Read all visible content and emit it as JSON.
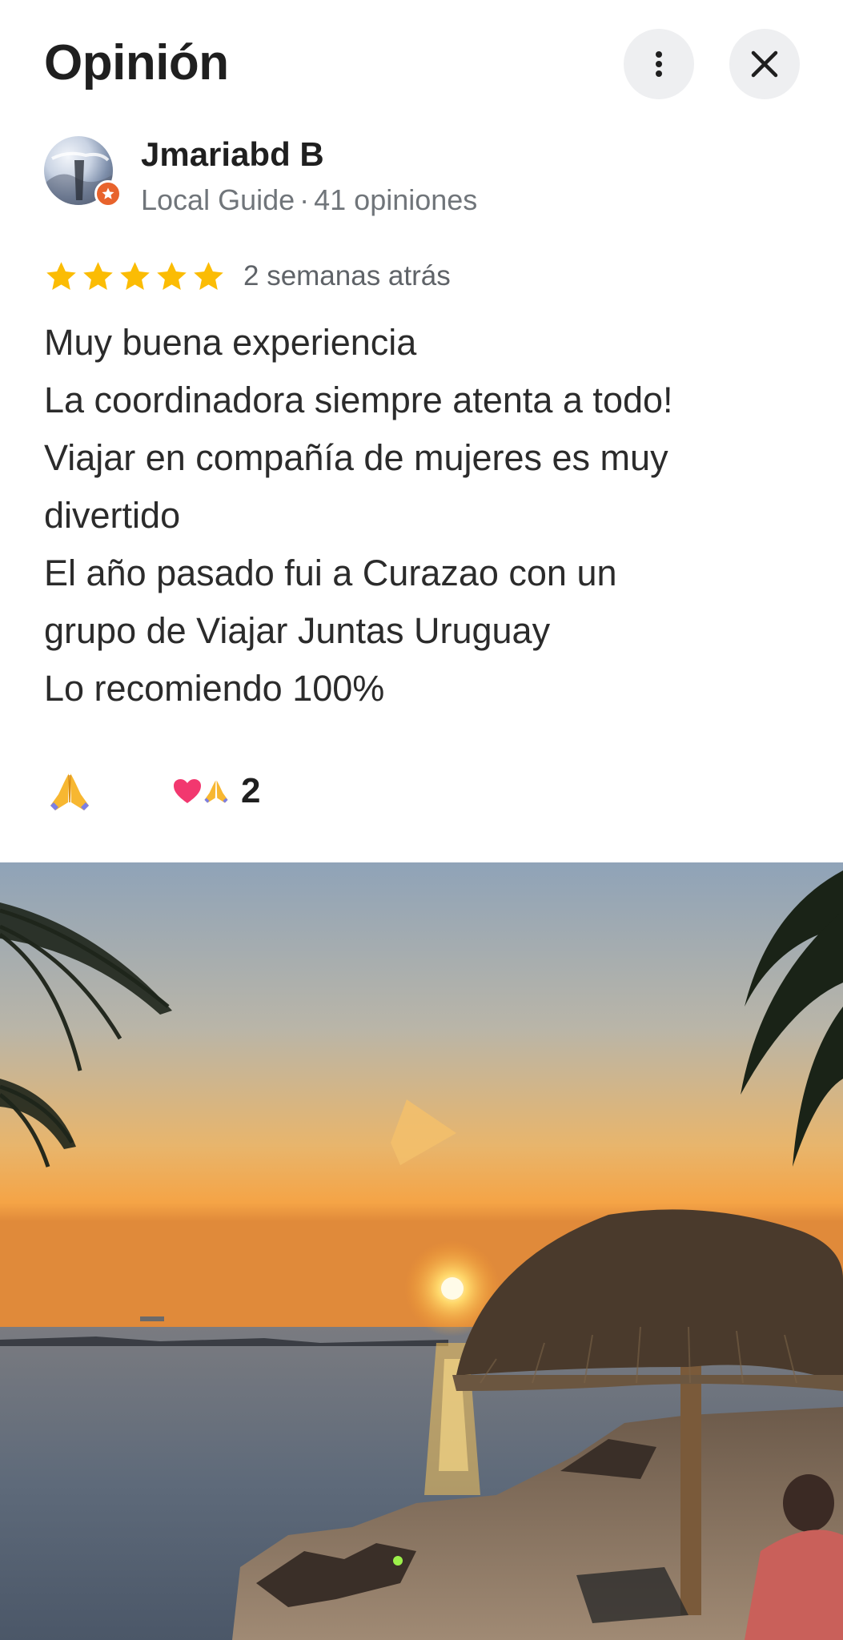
{
  "header": {
    "title": "Opinión",
    "more_icon": "more-vert-icon",
    "close_icon": "close-icon"
  },
  "author": {
    "name": "Jmariabd B",
    "badge": "Local Guide",
    "separator": "·",
    "reviews_count": "41 opiniones",
    "badge_icon": "local-guide-star-icon",
    "badge_color": "#e8632c"
  },
  "review": {
    "rating": 5,
    "max_rating": 5,
    "time": "2 semanas atrás",
    "lines": [
      "Muy buena experiencia",
      "La coordinadora siempre atenta a todo!",
      "Viajar en compañía de mujeres es muy",
      "divertido",
      "El año pasado fui a Curazao con un",
      "grupo de Viajar Juntas Uruguay",
      "Lo recomiendo 100%"
    ],
    "star_color": "#fbbc04"
  },
  "reactions": {
    "react_icon": "pray-icon",
    "summary_icons": [
      "heart-icon",
      "pray-icon"
    ],
    "count": "2"
  },
  "photo": {
    "icon": "beach-sunset-photo"
  }
}
